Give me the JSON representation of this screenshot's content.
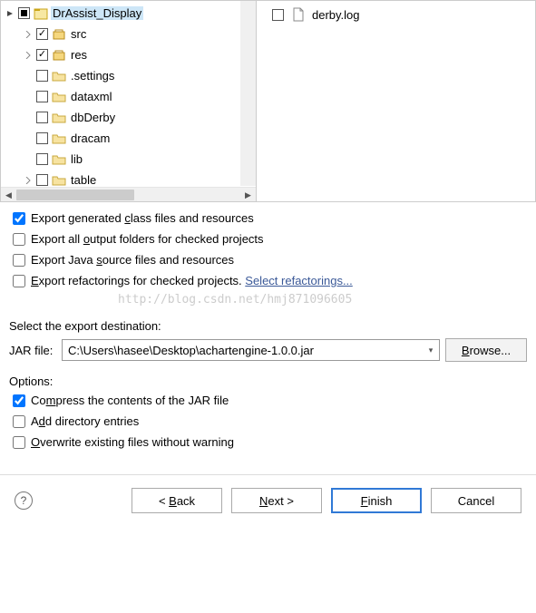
{
  "tree": {
    "root": {
      "label": "DrAssist_Display"
    },
    "children": [
      {
        "label": "src",
        "kind": "package"
      },
      {
        "label": "res",
        "kind": "package"
      },
      {
        "label": ".settings",
        "kind": "folder"
      },
      {
        "label": "dataxml",
        "kind": "folder"
      },
      {
        "label": "dbDerby",
        "kind": "folder"
      },
      {
        "label": "dracam",
        "kind": "folder"
      },
      {
        "label": "lib",
        "kind": "folder"
      },
      {
        "label": "table",
        "kind": "folder"
      }
    ]
  },
  "right_panel": {
    "items": [
      {
        "label": "derby.log"
      }
    ]
  },
  "export_options": {
    "generated": "Export generated ",
    "generated_u": "c",
    "generated_rest": "lass files and resources",
    "output": "Export all ",
    "output_u": "o",
    "output_rest": "utput folders for checked projects",
    "source": "Export Java ",
    "source_u": "s",
    "source_rest": "ource files and resources",
    "refactor": "",
    "refactor_u": "E",
    "refactor_rest": "xport refactorings for checked projects. ",
    "refactor_link": "Select refactorings..."
  },
  "watermark": "http://blog.csdn.net/hmj871096605",
  "destination": {
    "label": "Select the export destination:",
    "field_label": "JAR file:",
    "value": "C:\\Users\\hasee\\Desktop\\achartengine-1.0.0.jar",
    "browse_u": "B",
    "browse_label": "rowse..."
  },
  "options": {
    "heading": "Options:",
    "compress": "Co",
    "compress_u": "m",
    "compress_rest": "press the contents of the JAR file",
    "add_dir": "A",
    "add_dir_u": "d",
    "add_dir_rest": "d directory entries",
    "overwrite": "",
    "overwrite_u": "O",
    "overwrite_rest": "verwrite existing files without warning"
  },
  "buttons": {
    "back": "< ",
    "back_u": "B",
    "back_rest": "ack",
    "next_u": "N",
    "next_rest": "ext >",
    "finish_u": "F",
    "finish_rest": "inish",
    "cancel": "Cancel"
  }
}
